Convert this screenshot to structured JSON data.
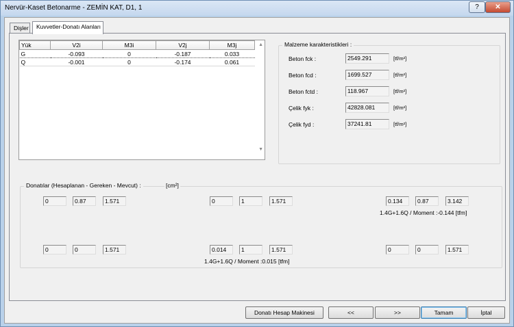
{
  "window": {
    "title": "Nervür-Kaset Betonarme - ZEMİN KAT, D1, 1",
    "help": "?",
    "close": "✕"
  },
  "tabs": [
    {
      "label": "Dişler"
    },
    {
      "label": "Kuvvetler-Donatı Alanları"
    }
  ],
  "grid": {
    "columns": [
      "Yük",
      "V2i",
      "M3i",
      "V2j",
      "M3j"
    ],
    "rows": [
      {
        "yuk": "G",
        "v2i": "-0.093",
        "m3i": "0",
        "v2j": "-0.187",
        "m3j": "0.033"
      },
      {
        "yuk": "Q",
        "v2i": "-0.001",
        "m3i": "0",
        "v2j": "-0.174",
        "m3j": "0.061"
      }
    ],
    "scroll_up": "▲",
    "scroll_down": "▼"
  },
  "material": {
    "title": "Malzeme karakteristikleri :",
    "rows": [
      {
        "label": "Beton fck :",
        "value": "2549.291",
        "unit": "[tf/m²]"
      },
      {
        "label": "Beton fcd :",
        "value": "1699.527",
        "unit": "[tf/m²]"
      },
      {
        "label": "Beton fctd :",
        "value": "118.967",
        "unit": "[tf/m²]"
      },
      {
        "label": "Çelik fyk :",
        "value": "42828.081",
        "unit": "[tf/m²]"
      },
      {
        "label": "Çelik fyd :",
        "value": "37241.81",
        "unit": "[tf/m²]"
      }
    ]
  },
  "donati": {
    "title": "Donatılar (Hesaplanan - Gereken - Mevcut) :",
    "unit": "[cm²]",
    "groups": [
      {
        "values": [
          "0",
          "0.87",
          "1.571"
        ],
        "note": ""
      },
      {
        "values": [
          "0",
          "1",
          "1.571"
        ],
        "note": ""
      },
      {
        "values": [
          "0.134",
          "0.87",
          "3.142"
        ],
        "note": "1.4G+1.6Q  / Moment  :-0.144 [tfm]"
      },
      {
        "values": [
          "0",
          "0",
          "1.571"
        ],
        "note": ""
      },
      {
        "values": [
          "0.014",
          "1",
          "1.571"
        ],
        "note": "1.4G+1.6Q  / Moment :0.015 [tfm]"
      },
      {
        "values": [
          "0",
          "0",
          "1.571"
        ],
        "note": ""
      }
    ]
  },
  "buttons": {
    "calc": "Donatı Hesap Makinesi",
    "prev": "<<",
    "next": ">>",
    "ok": "Tamam",
    "cancel": "İptal"
  }
}
